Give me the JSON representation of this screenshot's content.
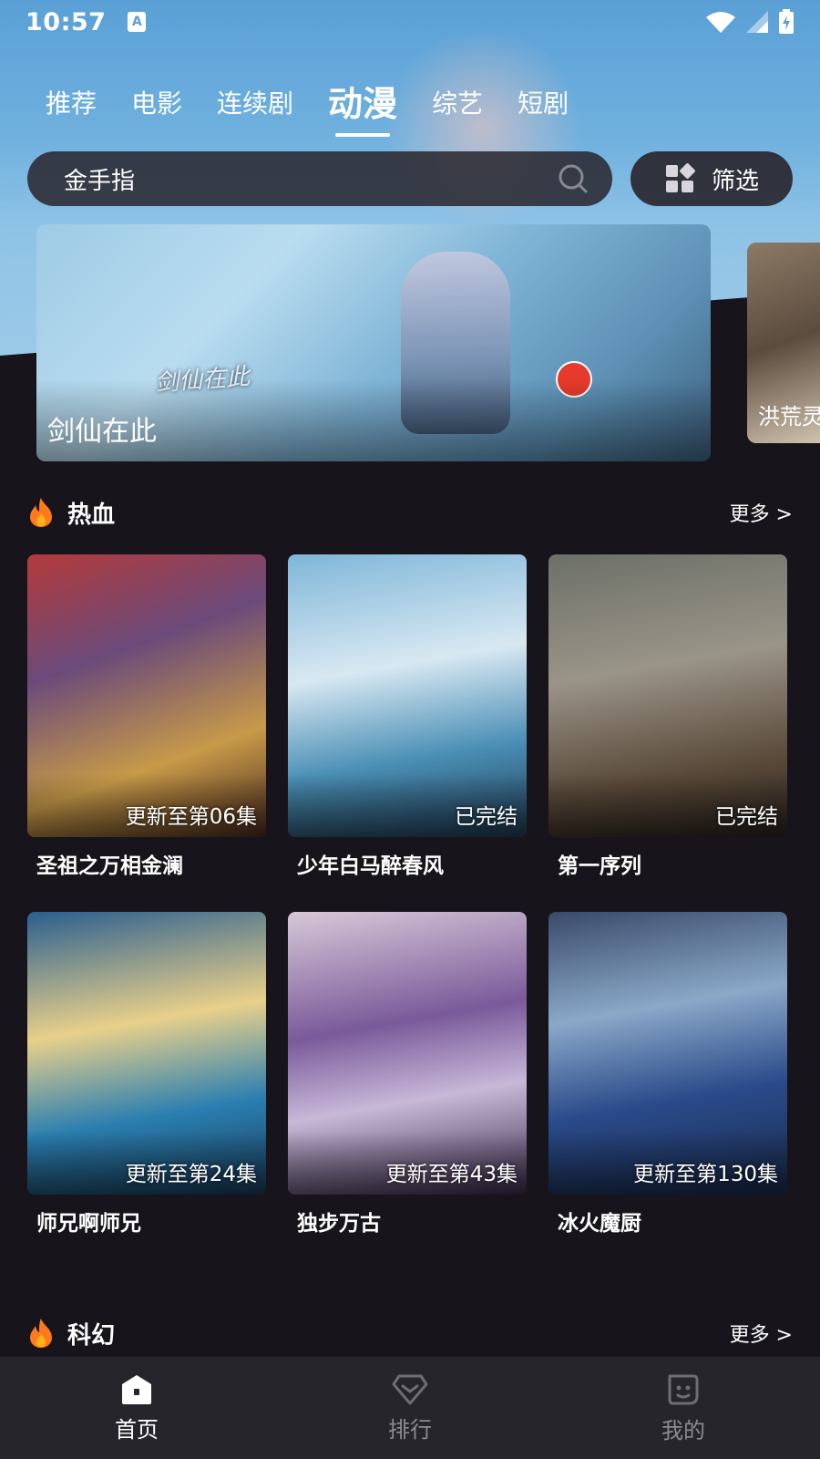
{
  "status_bar": {
    "time": "10:57",
    "input_icon_label": "A"
  },
  "tabs": [
    {
      "label": "推荐",
      "active": false
    },
    {
      "label": "电影",
      "active": false
    },
    {
      "label": "连续剧",
      "active": false
    },
    {
      "label": "动漫",
      "active": true
    },
    {
      "label": "综艺",
      "active": false
    },
    {
      "label": "短剧",
      "active": false
    }
  ],
  "search": {
    "value": "金手指",
    "icon": "search-icon"
  },
  "filter": {
    "label": "筛选",
    "icon": "grid-icon"
  },
  "banner": {
    "items": [
      {
        "title": "剑仙在此",
        "logo_text": "剑仙在此"
      },
      {
        "title": "洪荒灵"
      }
    ]
  },
  "sections": [
    {
      "title": "热血",
      "more_label": "更多 >",
      "icon": "flame-icon",
      "cards": [
        {
          "title": "圣祖之万相金澜",
          "status": "更新至第06集"
        },
        {
          "title": "少年白马醉春风",
          "status": "已完结"
        },
        {
          "title": "第一序列",
          "status": "已完结"
        },
        {
          "title": "师兄啊师兄",
          "status": "更新至第24集"
        },
        {
          "title": "独步万古",
          "status": "更新至第43集"
        },
        {
          "title": "冰火魔厨",
          "status": "更新至第130集"
        }
      ]
    },
    {
      "title": "科幻",
      "more_label": "更多 >",
      "icon": "flame-icon"
    }
  ],
  "bottom_nav": [
    {
      "label": "首页",
      "icon": "home-icon",
      "active": true
    },
    {
      "label": "排行",
      "icon": "ranking-icon",
      "active": false
    },
    {
      "label": "我的",
      "icon": "profile-icon",
      "active": false
    }
  ],
  "colors": {
    "accent_flame": "#ff7a1a",
    "background": "#17151b",
    "nav_background": "#26252b"
  }
}
